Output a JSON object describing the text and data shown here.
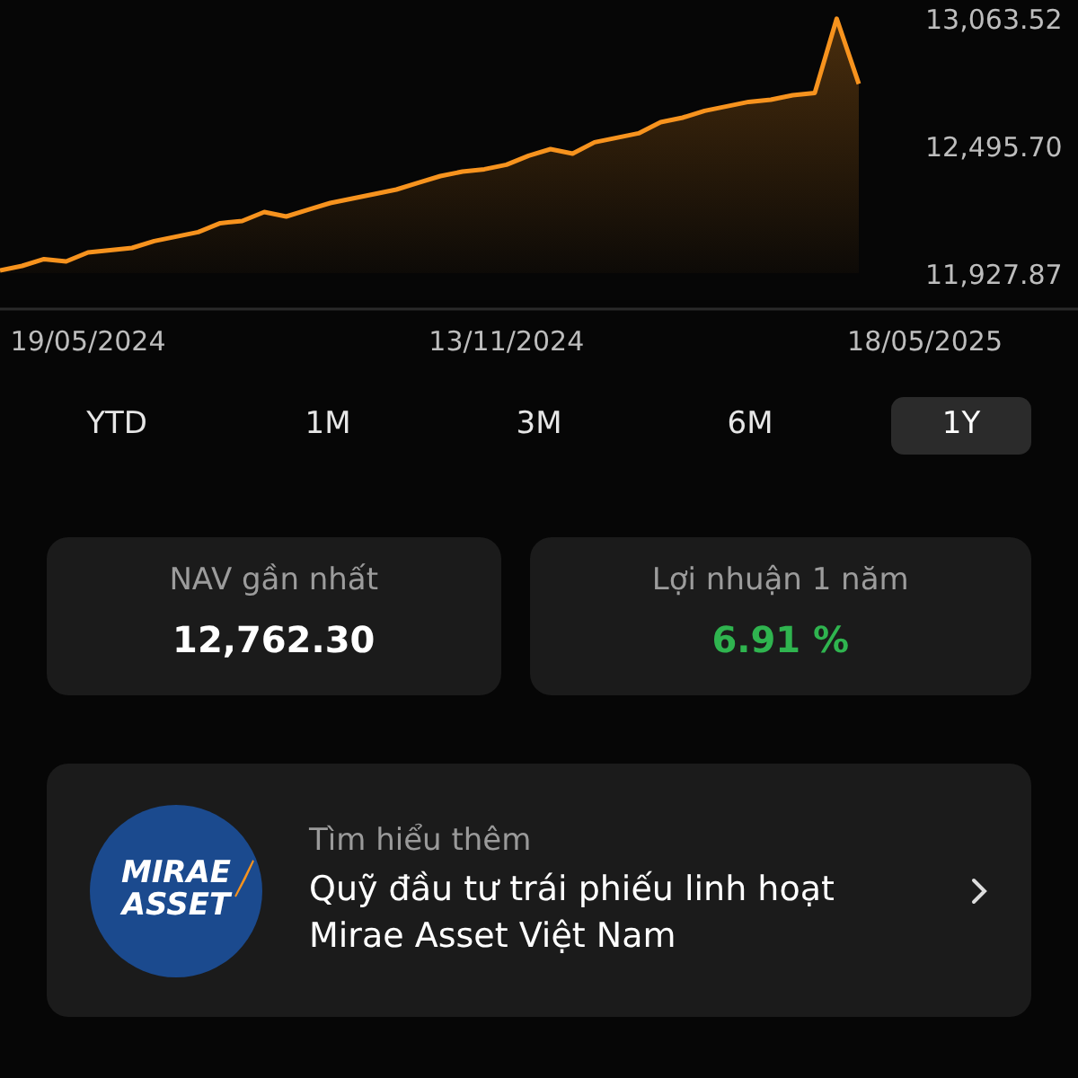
{
  "chart": {
    "chart_data": {
      "type": "area",
      "categories": [
        null,
        null,
        null,
        null,
        "19/05/2024",
        null,
        null,
        null,
        null,
        null,
        null,
        null,
        null,
        null,
        null,
        null,
        null,
        null,
        null,
        null,
        null,
        null,
        null,
        "13/11/2024",
        null,
        null,
        null,
        null,
        null,
        null,
        null,
        null,
        null,
        null,
        null,
        null,
        null,
        null,
        null,
        null,
        null,
        null,
        "18/05/2025"
      ],
      "series": [
        {
          "color": "#f7931e",
          "values": [
            11940,
            11960,
            11990,
            11980,
            12020,
            12030,
            12040,
            12070,
            12090,
            12110,
            12150,
            12160,
            12200,
            12180,
            12210,
            12240,
            12260,
            12280,
            12300,
            12330,
            12360,
            12380,
            12390,
            12410,
            12450,
            12480,
            12460,
            12510,
            12530,
            12550,
            12600,
            12620,
            12650,
            12670,
            12690,
            12700,
            12720,
            12730,
            13060,
            12770,
            null,
            null,
            null
          ]
        }
      ],
      "ylim": [
        11927.87,
        13063.52
      ],
      "yticks": [
        {
          "value": 13063.52,
          "label": "13,063.52"
        },
        {
          "value": 12495.7,
          "label": "12,495.70"
        },
        {
          "value": 11927.87,
          "label": "11,927.87"
        }
      ]
    }
  },
  "periods": [
    {
      "label": "YTD",
      "selected": false
    },
    {
      "label": "1M",
      "selected": false
    },
    {
      "label": "3M",
      "selected": false
    },
    {
      "label": "6M",
      "selected": false
    },
    {
      "label": "1Y",
      "selected": true
    }
  ],
  "stats": [
    {
      "label": "NAV gần nhất",
      "value": "12,762.30",
      "kind": "plain"
    },
    {
      "label": "Lợi nhuận 1 năm",
      "value": "6.91 %",
      "kind": "gain"
    }
  ],
  "fund_card": {
    "logo_text": "MIRAE ASSET",
    "eyebrow": "Tìm hiểu thêm",
    "title": "Quỹ đầu tư trái phiếu linh hoạt Mirae Asset Việt Nam"
  }
}
